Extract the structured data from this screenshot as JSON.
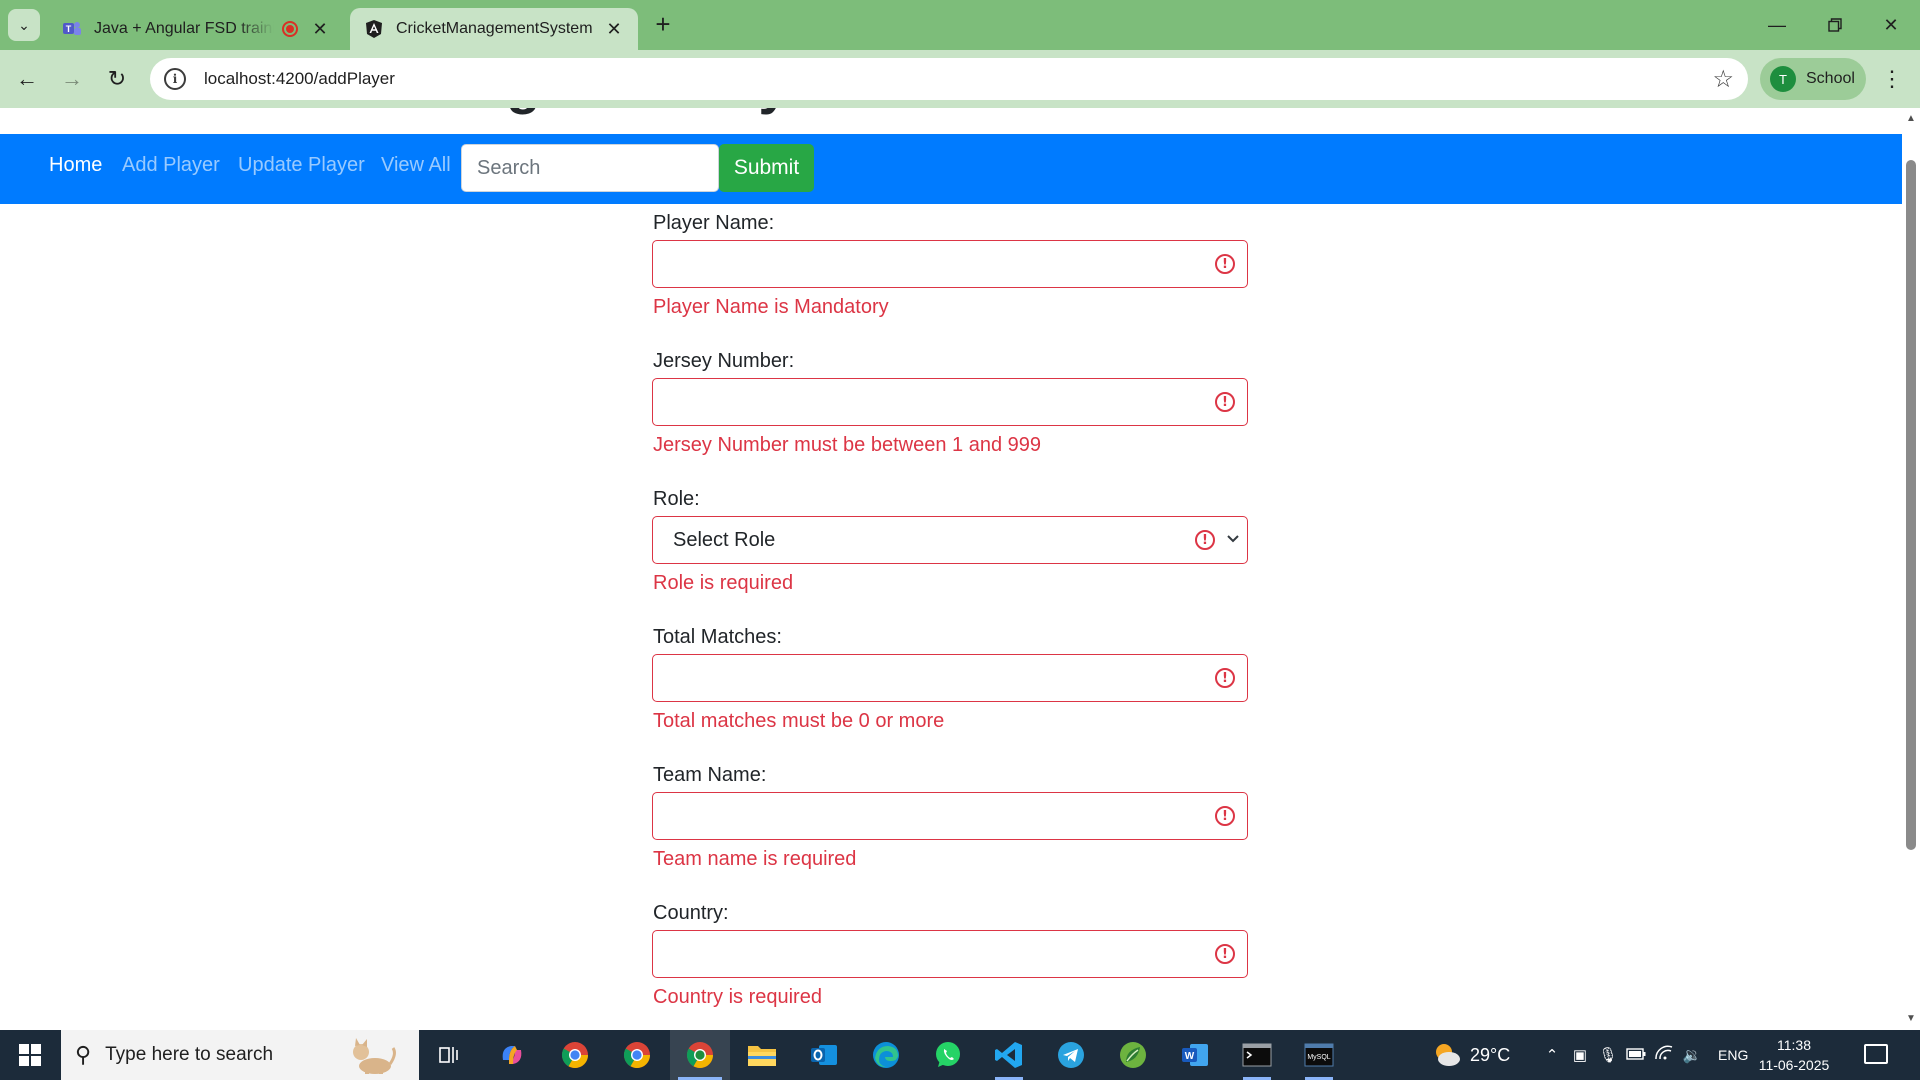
{
  "browser": {
    "tabs": [
      {
        "title": "Java + Angular FSD training",
        "icon": "teams-icon",
        "recording": true
      },
      {
        "title": "CricketManagementSystem",
        "icon": "angular-icon",
        "active": true
      }
    ],
    "url": "localhost:4200/addPlayer",
    "profile_label": "School",
    "profile_initial": "T"
  },
  "page": {
    "heading": "Cricket Team Management System",
    "nav": {
      "links": [
        "Home",
        "Add Player",
        "Update Player",
        "View All"
      ],
      "search_placeholder": "Search",
      "submit_label": "Submit"
    },
    "form": {
      "fields": [
        {
          "label": "Player Name:",
          "error": "Player Name is Mandatory",
          "type": "text",
          "value": ""
        },
        {
          "label": "Jersey Number:",
          "error": "Jersey Number must be between 1 and 999",
          "type": "number",
          "value": ""
        },
        {
          "label": "Role:",
          "error": "Role is required",
          "type": "select",
          "value": "Select Role"
        },
        {
          "label": "Total Matches:",
          "error": "Total matches must be 0 or more",
          "type": "number",
          "value": ""
        },
        {
          "label": "Team Name:",
          "error": "Team name is required",
          "type": "text",
          "value": ""
        },
        {
          "label": "Country:",
          "error": "Country is required",
          "type": "text",
          "value": ""
        }
      ]
    }
  },
  "taskbar": {
    "search_placeholder": "Type here to search",
    "weather": "29°C",
    "language": "ENG",
    "time": "11:38",
    "date": "11-06-2025",
    "apps": [
      "task-view-icon",
      "copilot-icon",
      "chrome-icon",
      "chrome-icon",
      "chrome-icon",
      "file-explorer-icon",
      "outlook-icon",
      "edge-icon",
      "whatsapp-icon",
      "vscode-icon",
      "telegram-icon",
      "spring-tool-suite-icon",
      "word-icon",
      "terminal-icon",
      "mysql-icon"
    ]
  },
  "colors": {
    "tab_strip": "#7dbd7a",
    "toolbar": "#c8e3c6",
    "navbar": "#007bff",
    "submit": "#28a745",
    "error": "#dc3545"
  }
}
